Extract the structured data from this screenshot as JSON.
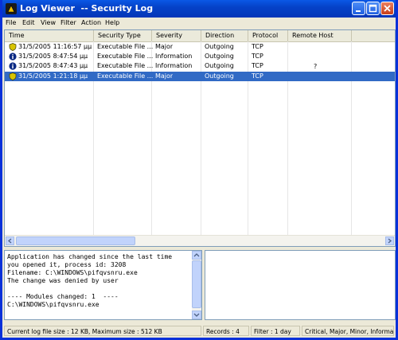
{
  "window": {
    "title": "Log Viewer  -- Security Log"
  },
  "menu": [
    "File",
    "Edit",
    "View",
    "Filter",
    "Action",
    "Help"
  ],
  "columns": [
    "Time",
    "Security Type",
    "Severity",
    "Direction",
    "Protocol",
    "Remote Host"
  ],
  "rows": [
    {
      "icon": "shield-icon",
      "time": "31/5/2005 11:16:57 μμ",
      "type": "Executable File ...",
      "severity": "Major",
      "direction": "Outgoing",
      "protocol": "TCP",
      "host": ""
    },
    {
      "icon": "info-icon",
      "time": "31/5/2005 8:47:54 μμ",
      "type": "Executable File ...",
      "severity": "Information",
      "direction": "Outgoing",
      "protocol": "TCP",
      "host": "?"
    },
    {
      "icon": "info-icon",
      "time": "31/5/2005 8:47:43 μμ",
      "type": "Executable File ...",
      "severity": "Information",
      "direction": "Outgoing",
      "protocol": "TCP",
      "host": ""
    },
    {
      "icon": "shield-icon",
      "time": "31/5/2005 1:21:18 μμ",
      "type": "Executable File ...",
      "severity": "Major",
      "direction": "Outgoing",
      "protocol": "TCP",
      "host": "",
      "selected": true
    }
  ],
  "details": {
    "lines": [
      "Application has changed since the last time",
      "you opened it, process id: 3208",
      "Filename: C:\\WINDOWS\\pifqvsnru.exe",
      "The change was denied by user",
      "",
      "---- Modules changed: 1  ----",
      "C:\\WINDOWS\\pifqvsnru.exe"
    ]
  },
  "status": {
    "size": "Current log file size : 12 KB, Maximum size : 512 KB",
    "records": "Records : 4",
    "filter": "Filter : 1 day",
    "levels": "Critical, Major, Minor, Informa"
  },
  "colors": {
    "title_bar": "#0542c8",
    "selection": "#316ac5",
    "face": "#ece9d8"
  }
}
